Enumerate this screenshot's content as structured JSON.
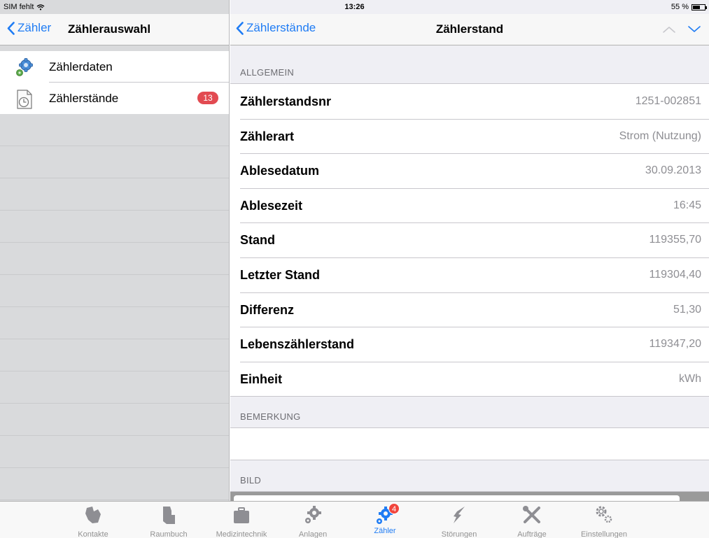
{
  "status_bar": {
    "carrier": "SIM fehlt",
    "time": "13:26",
    "battery_text": "55 %",
    "battery_level": 0.55
  },
  "master": {
    "back_label": "Zähler",
    "title": "Zählerauswahl",
    "items": [
      {
        "label": "Zählerdaten",
        "icon": "gears-icon"
      },
      {
        "label": "Zählerstände",
        "icon": "clock-document-icon",
        "badge": "13"
      }
    ]
  },
  "detail": {
    "back_label": "Zählerstände",
    "title": "Zählerstand",
    "sections": {
      "general": "ALLGEMEIN",
      "remark": "BEMERKUNG",
      "image": "BILD"
    },
    "fields": [
      {
        "label": "Zählerstandsnr",
        "value": "1251-002851"
      },
      {
        "label": "Zählerart",
        "value": "Strom (Nutzung)"
      },
      {
        "label": "Ablesedatum",
        "value": "30.09.2013"
      },
      {
        "label": "Ablesezeit",
        "value": "16:45"
      },
      {
        "label": "Stand",
        "value": "119355,70"
      },
      {
        "label": "Letzter Stand",
        "value": "119304,40"
      },
      {
        "label": "Differenz",
        "value": "51,30"
      },
      {
        "label": "Lebenszählerstand",
        "value": "119347,20"
      },
      {
        "label": "Einheit",
        "value": "kWh"
      }
    ]
  },
  "tabs": [
    {
      "label": "Kontakte",
      "icon": "contacts-icon"
    },
    {
      "label": "Raumbuch",
      "icon": "room-book-icon"
    },
    {
      "label": "Medizintechnik",
      "icon": "medical-case-icon"
    },
    {
      "label": "Anlagen",
      "icon": "gear-icon"
    },
    {
      "label": "Zähler",
      "icon": "meter-gears-icon",
      "badge": "4",
      "active": true
    },
    {
      "label": "Störungen",
      "icon": "lightning-icon"
    },
    {
      "label": "Aufträge",
      "icon": "tools-icon"
    },
    {
      "label": "Einstellungen",
      "icon": "settings-icon"
    }
  ],
  "colors": {
    "accent": "#1f7cf4",
    "badge": "#e24a51",
    "inactive_tab": "#929292"
  }
}
